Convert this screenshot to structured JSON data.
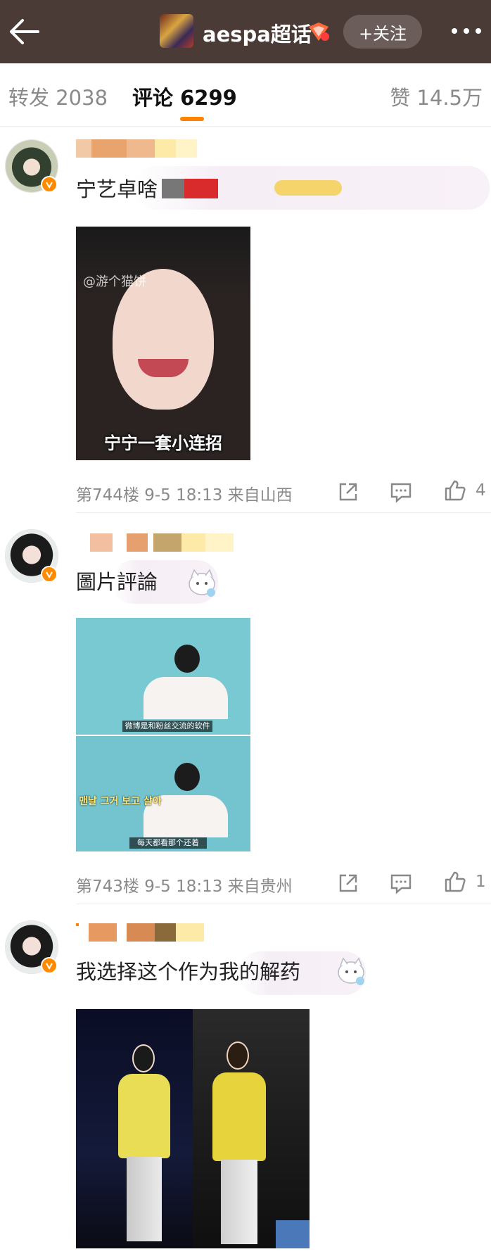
{
  "header": {
    "back_icon": "arrow-left-icon",
    "topic_title": "aespa超话",
    "badge_icon": "level-badge-icon",
    "follow_label": "+关注",
    "more_icon": "more-dots-icon"
  },
  "tabs": {
    "repost": "转发 2038",
    "comment": "评论 6299",
    "like": "赞 14.5万",
    "accent": "#ff8200"
  },
  "comments": [
    {
      "text": "宁艺卓啥",
      "image_caption": "宁宁一套小连招",
      "image_watermark": "@游个猫饼",
      "meta": "第744楼  9-5 18:13  来自山西",
      "likes": "4"
    },
    {
      "text": "圖片評論",
      "image_caption_top": "微博是和粉丝交流的软件",
      "image_caption_korean": "맨날 그거 보고 살아",
      "image_caption_bottom": "每天都看那个还着",
      "meta": "第743楼  9-5 18:13  来自贵州",
      "likes": "1"
    },
    {
      "text": "我选择这个作为我的解药"
    }
  ]
}
